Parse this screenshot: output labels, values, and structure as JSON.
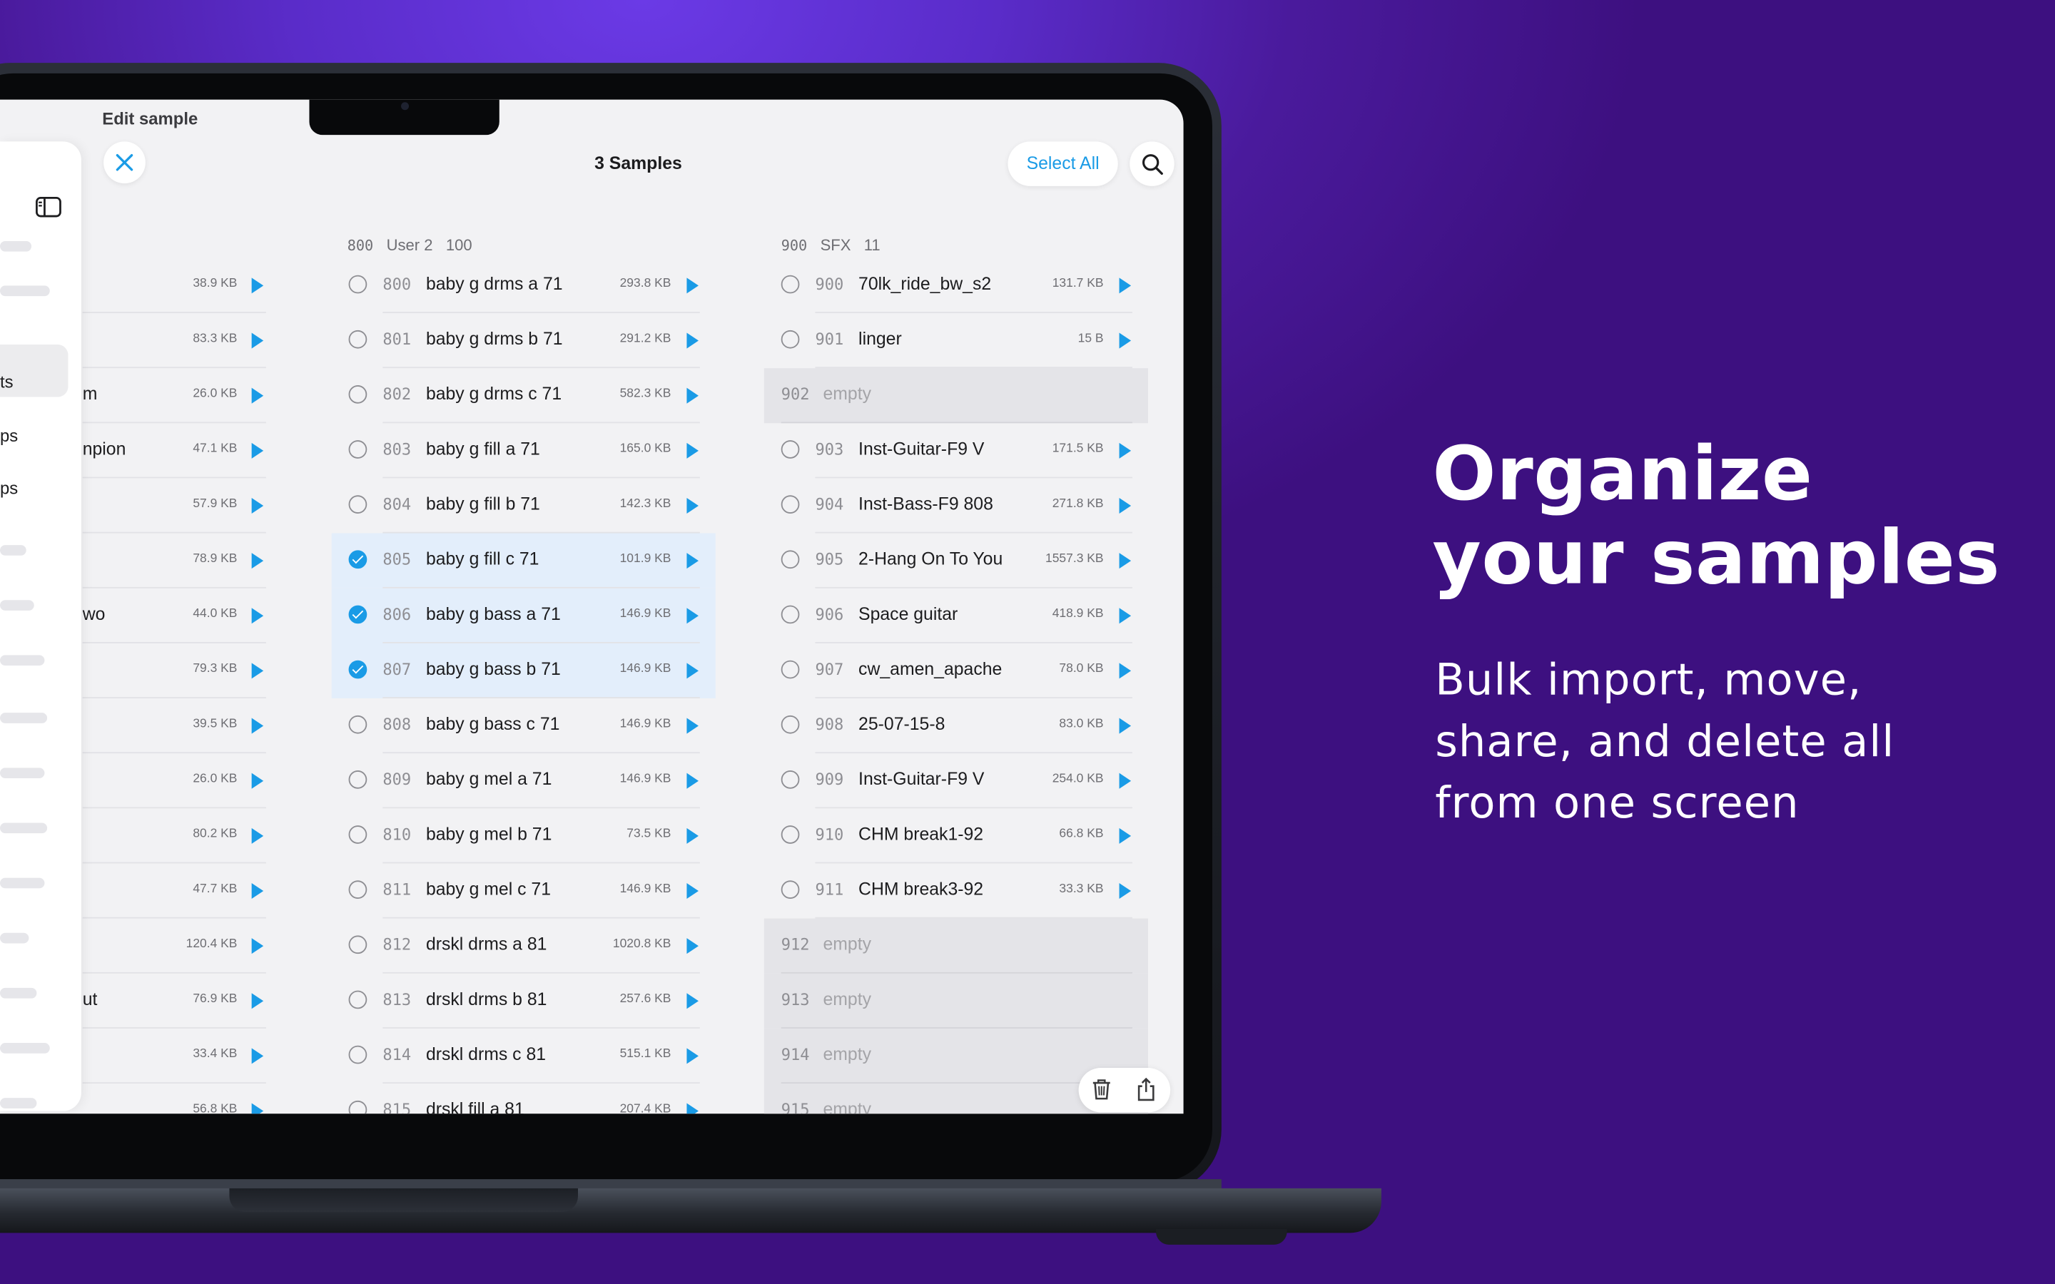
{
  "marketing": {
    "headline_line1": "Organize",
    "headline_line2": "your samples",
    "subtext": "Bulk import, move, share, and delete all from one screen"
  },
  "app": {
    "edit_title": "Edit sample",
    "header_title": "3 Samples",
    "select_all_label": "Select All",
    "accent_color": "#1a9be6"
  },
  "sidebar": {
    "visible_fragments": [
      "ts",
      "ps",
      "ps"
    ]
  },
  "columns": [
    {
      "head": [],
      "rows": [
        {
          "tail": "",
          "size": "38.9 KB"
        },
        {
          "tail": "",
          "size": "83.3 KB"
        },
        {
          "tail": "m",
          "size": "26.0 KB"
        },
        {
          "tail": "npion",
          "size": "47.1 KB"
        },
        {
          "tail": "",
          "size": "57.9 KB"
        },
        {
          "tail": "",
          "size": "78.9 KB"
        },
        {
          "tail": "wo",
          "size": "44.0 KB"
        },
        {
          "tail": "",
          "size": "79.3 KB"
        },
        {
          "tail": "",
          "size": "39.5 KB"
        },
        {
          "tail": "",
          "size": "26.0 KB"
        },
        {
          "tail": "",
          "size": "80.2 KB"
        },
        {
          "tail": "",
          "size": "47.7 KB"
        },
        {
          "tail": "",
          "size": "120.4 KB"
        },
        {
          "tail": "ut",
          "size": "76.9 KB"
        },
        {
          "tail": "",
          "size": "33.4 KB"
        },
        {
          "tail": "",
          "size": "56.8 KB"
        }
      ]
    },
    {
      "head": [
        "800",
        "User 2",
        "100"
      ],
      "rows": [
        {
          "num": "800",
          "name": "baby g drms a 71",
          "size": "293.8 KB",
          "selected": false
        },
        {
          "num": "801",
          "name": "baby g drms b 71",
          "size": "291.2 KB",
          "selected": false
        },
        {
          "num": "802",
          "name": "baby g drms c 71",
          "size": "582.3 KB",
          "selected": false
        },
        {
          "num": "803",
          "name": "baby g fill a 71",
          "size": "165.0 KB",
          "selected": false
        },
        {
          "num": "804",
          "name": "baby g fill b 71",
          "size": "142.3 KB",
          "selected": false
        },
        {
          "num": "805",
          "name": "baby g fill c 71",
          "size": "101.9 KB",
          "selected": true
        },
        {
          "num": "806",
          "name": "baby g bass a 71",
          "size": "146.9 KB",
          "selected": true
        },
        {
          "num": "807",
          "name": "baby g bass b 71",
          "size": "146.9 KB",
          "selected": true
        },
        {
          "num": "808",
          "name": "baby g bass c 71",
          "size": "146.9 KB",
          "selected": false
        },
        {
          "num": "809",
          "name": "baby g mel a 71",
          "size": "146.9 KB",
          "selected": false
        },
        {
          "num": "810",
          "name": "baby g mel b 71",
          "size": "73.5 KB",
          "selected": false
        },
        {
          "num": "811",
          "name": "baby g mel c 71",
          "size": "146.9 KB",
          "selected": false
        },
        {
          "num": "812",
          "name": "drskl drms a 81",
          "size": "1020.8 KB",
          "selected": false
        },
        {
          "num": "813",
          "name": "drskl drms b 81",
          "size": "257.6 KB",
          "selected": false
        },
        {
          "num": "814",
          "name": "drskl drms c 81",
          "size": "515.1 KB",
          "selected": false
        },
        {
          "num": "815",
          "name": "drskl fill a 81",
          "size": "207.4 KB",
          "selected": false
        }
      ]
    },
    {
      "head": [
        "900",
        "SFX",
        "11"
      ],
      "rows": [
        {
          "num": "900",
          "name": "70lk_ride_bw_s2",
          "size": "131.7 KB",
          "empty": false
        },
        {
          "num": "901",
          "name": "linger",
          "size": "15 B",
          "empty": false
        },
        {
          "num": "902",
          "name": "empty",
          "size": "",
          "empty": true
        },
        {
          "num": "903",
          "name": "Inst-Guitar-F9 V",
          "size": "171.5 KB",
          "empty": false
        },
        {
          "num": "904",
          "name": "Inst-Bass-F9 808",
          "size": "271.8 KB",
          "empty": false
        },
        {
          "num": "905",
          "name": "2-Hang On To You",
          "size": "1557.3 KB",
          "empty": false
        },
        {
          "num": "906",
          "name": "Space guitar",
          "size": "418.9 KB",
          "empty": false
        },
        {
          "num": "907",
          "name": "cw_amen_apache",
          "size": "78.0 KB",
          "empty": false
        },
        {
          "num": "908",
          "name": "25-07-15-8",
          "size": "83.0 KB",
          "empty": false
        },
        {
          "num": "909",
          "name": "Inst-Guitar-F9 V",
          "size": "254.0 KB",
          "empty": false
        },
        {
          "num": "910",
          "name": "CHM break1-92",
          "size": "66.8 KB",
          "empty": false
        },
        {
          "num": "911",
          "name": "CHM break3-92",
          "size": "33.3 KB",
          "empty": false
        },
        {
          "num": "912",
          "name": "empty",
          "size": "",
          "empty": true
        },
        {
          "num": "913",
          "name": "empty",
          "size": "",
          "empty": true
        },
        {
          "num": "914",
          "name": "empty",
          "size": "",
          "empty": true
        },
        {
          "num": "915",
          "name": "empty",
          "size": "",
          "empty": true
        }
      ]
    }
  ],
  "toolbar_icons": [
    "trash-icon",
    "share-icon"
  ]
}
